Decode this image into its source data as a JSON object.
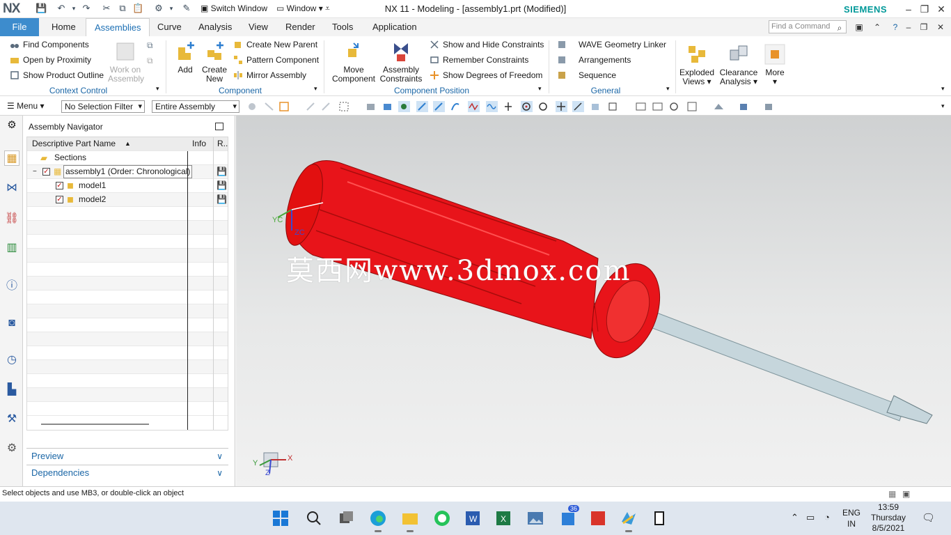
{
  "app": {
    "logo": "NX",
    "title": "NX 11 - Modeling - [assembly1.prt (Modified)]",
    "brand": "SIEMENS",
    "switch_window": "Switch Window",
    "window_menu": "Window"
  },
  "tabs": {
    "file": "File",
    "items": [
      "Home",
      "Assemblies",
      "Curve",
      "Analysis",
      "View",
      "Render",
      "Tools",
      "Application"
    ],
    "active": "Assemblies",
    "find_placeholder": "Find a Command"
  },
  "ribbon": {
    "context_control": {
      "find": "Find Components",
      "open": "Open by Proximity",
      "outline": "Show Product Outline",
      "work1": "Work on",
      "work2": "Assembly",
      "label": "Context Control"
    },
    "component": {
      "add": "Add",
      "create1": "Create",
      "create2": "New",
      "new_parent": "Create New Parent",
      "pattern": "Pattern Component",
      "mirror": "Mirror Assembly",
      "label": "Component"
    },
    "position": {
      "move1": "Move",
      "move2": "Component",
      "asm1": "Assembly",
      "asm2": "Constraints",
      "show_hide": "Show and Hide Constraints",
      "remember": "Remember Constraints",
      "dof": "Show Degrees of Freedom",
      "label": "Component Position"
    },
    "general": {
      "wave": "WAVE Geometry Linker",
      "arrange": "Arrangements",
      "sequence": "Sequence",
      "label": "General"
    },
    "exploded1": "Exploded",
    "exploded2": "Views",
    "clearance1": "Clearance",
    "clearance2": "Analysis",
    "more": "More"
  },
  "toolbar2": {
    "menu": "Menu",
    "filter": "No Selection Filter",
    "scope": "Entire Assembly"
  },
  "navigator": {
    "title": "Assembly Navigator",
    "columns": [
      "Descriptive Part Name",
      "Info",
      "R.."
    ],
    "rows": [
      {
        "name": "Sections"
      },
      {
        "name": "assembly1 (Order: Chronological)"
      },
      {
        "name": "model1"
      },
      {
        "name": "model2"
      }
    ],
    "preview": "Preview",
    "dependencies": "Dependencies"
  },
  "viewport": {
    "watermark": "莫西网www.3dmox.com",
    "handle_color": "#e8141a",
    "shaft_color": "#c6d6dc",
    "axes": {
      "x": "X",
      "y": "Y",
      "z": "Z",
      "yc": "YC",
      "zc": "ZC"
    }
  },
  "status": {
    "message": "Select objects and use MB3, or double-click an object"
  },
  "taskbar": {
    "lang1": "ENG",
    "lang2": "IN",
    "time": "13:59",
    "day": "Thursday",
    "date": "8/5/2021",
    "badge": "36"
  }
}
